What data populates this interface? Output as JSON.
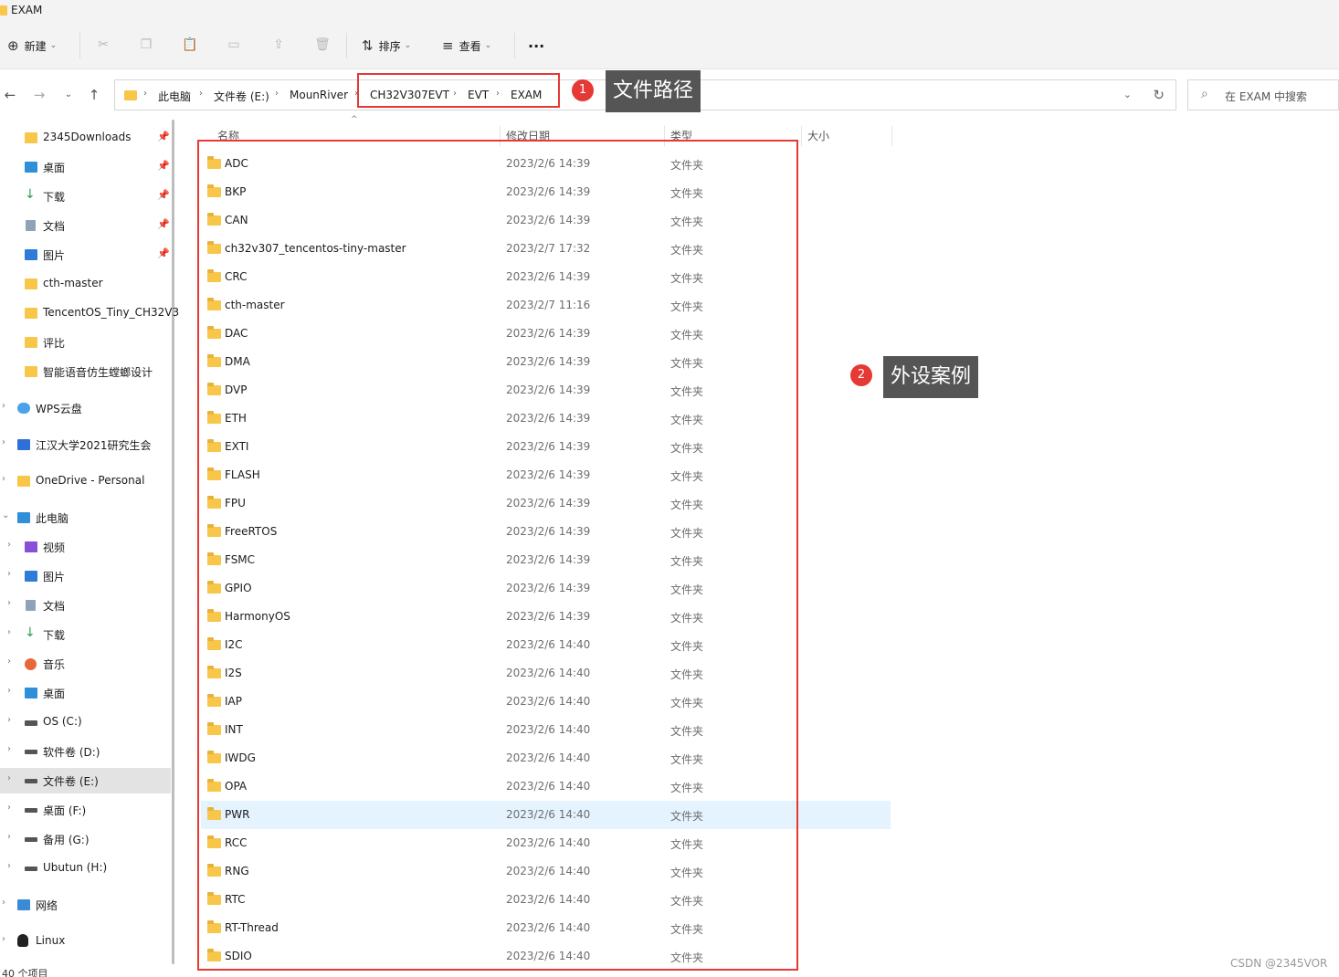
{
  "window": {
    "title": "EXAM"
  },
  "toolbar": {
    "new_label": "新建",
    "sort_label": "排序",
    "view_label": "查看",
    "more_label": "···"
  },
  "nav": {
    "breadcrumbs": [
      "此电脑",
      "文件卷 (E:)",
      "MounRiver",
      "CH32V307EVT",
      "EVT",
      "EXAM"
    ],
    "search_placeholder": "在 EXAM 中搜索"
  },
  "annotations": [
    {
      "number": "1",
      "text": "文件路径"
    },
    {
      "number": "2",
      "text": "外设案例"
    }
  ],
  "sidebar": {
    "quick_access": [
      {
        "label": "2345Downloads",
        "icon": "folder-icon",
        "pinned": true
      },
      {
        "label": "桌面",
        "icon": "desktop-icon",
        "pinned": true
      },
      {
        "label": "下载",
        "icon": "download-icon",
        "pinned": true
      },
      {
        "label": "文档",
        "icon": "document-icon",
        "pinned": true
      },
      {
        "label": "图片",
        "icon": "picture-icon",
        "pinned": true
      },
      {
        "label": "cth-master",
        "icon": "folder-icon",
        "pinned": false
      },
      {
        "label": "TencentOS_Tiny_CH32V3",
        "icon": "folder-icon",
        "pinned": false
      },
      {
        "label": "评比",
        "icon": "folder-icon",
        "pinned": false
      },
      {
        "label": "智能语音仿生螳螂设计",
        "icon": "folder-icon",
        "pinned": false
      }
    ],
    "roots": [
      {
        "label": "WPS云盘",
        "icon": "cloud-icon"
      },
      {
        "label": "江汉大学2021研究生会",
        "icon": "cloud-drive-icon"
      },
      {
        "label": "OneDrive - Personal",
        "icon": "onedrive-folder-icon"
      },
      {
        "label": "此电脑",
        "icon": "pc-icon"
      }
    ],
    "this_pc": [
      {
        "label": "视频",
        "icon": "video-icon"
      },
      {
        "label": "图片",
        "icon": "picture-icon"
      },
      {
        "label": "文档",
        "icon": "document-icon"
      },
      {
        "label": "下载",
        "icon": "download-icon"
      },
      {
        "label": "音乐",
        "icon": "music-icon"
      },
      {
        "label": "桌面",
        "icon": "desktop-icon"
      },
      {
        "label": "OS (C:)",
        "icon": "system-drive-icon"
      },
      {
        "label": "软件卷 (D:)",
        "icon": "drive-icon"
      },
      {
        "label": "文件卷 (E:)",
        "icon": "drive-icon",
        "selected": true
      },
      {
        "label": "桌面 (F:)",
        "icon": "drive-icon"
      },
      {
        "label": "备用 (G:)",
        "icon": "drive-icon"
      },
      {
        "label": "Ubutun (H:)",
        "icon": "drive-icon"
      }
    ],
    "bottom": [
      {
        "label": "网络",
        "icon": "network-icon"
      },
      {
        "label": "Linux",
        "icon": "linux-icon"
      }
    ],
    "status": "40 个项目"
  },
  "columns": {
    "name": "名称",
    "date": "修改日期",
    "type": "类型",
    "size": "大小"
  },
  "files": [
    {
      "name": "ADC",
      "date": "2023/2/6 14:39",
      "type": "文件夹"
    },
    {
      "name": "BKP",
      "date": "2023/2/6 14:39",
      "type": "文件夹"
    },
    {
      "name": "CAN",
      "date": "2023/2/6 14:39",
      "type": "文件夹"
    },
    {
      "name": "ch32v307_tencentos-tiny-master",
      "date": "2023/2/7 17:32",
      "type": "文件夹"
    },
    {
      "name": "CRC",
      "date": "2023/2/6 14:39",
      "type": "文件夹"
    },
    {
      "name": "cth-master",
      "date": "2023/2/7 11:16",
      "type": "文件夹"
    },
    {
      "name": "DAC",
      "date": "2023/2/6 14:39",
      "type": "文件夹"
    },
    {
      "name": "DMA",
      "date": "2023/2/6 14:39",
      "type": "文件夹"
    },
    {
      "name": "DVP",
      "date": "2023/2/6 14:39",
      "type": "文件夹"
    },
    {
      "name": "ETH",
      "date": "2023/2/6 14:39",
      "type": "文件夹"
    },
    {
      "name": "EXTI",
      "date": "2023/2/6 14:39",
      "type": "文件夹"
    },
    {
      "name": "FLASH",
      "date": "2023/2/6 14:39",
      "type": "文件夹"
    },
    {
      "name": "FPU",
      "date": "2023/2/6 14:39",
      "type": "文件夹"
    },
    {
      "name": "FreeRTOS",
      "date": "2023/2/6 14:39",
      "type": "文件夹"
    },
    {
      "name": "FSMC",
      "date": "2023/2/6 14:39",
      "type": "文件夹"
    },
    {
      "name": "GPIO",
      "date": "2023/2/6 14:39",
      "type": "文件夹"
    },
    {
      "name": "HarmonyOS",
      "date": "2023/2/6 14:39",
      "type": "文件夹"
    },
    {
      "name": "I2C",
      "date": "2023/2/6 14:40",
      "type": "文件夹"
    },
    {
      "name": "I2S",
      "date": "2023/2/6 14:40",
      "type": "文件夹"
    },
    {
      "name": "IAP",
      "date": "2023/2/6 14:40",
      "type": "文件夹"
    },
    {
      "name": "INT",
      "date": "2023/2/6 14:40",
      "type": "文件夹"
    },
    {
      "name": "IWDG",
      "date": "2023/2/6 14:40",
      "type": "文件夹"
    },
    {
      "name": "OPA",
      "date": "2023/2/6 14:40",
      "type": "文件夹"
    },
    {
      "name": "PWR",
      "date": "2023/2/6 14:40",
      "type": "文件夹",
      "highlighted": true
    },
    {
      "name": "RCC",
      "date": "2023/2/6 14:40",
      "type": "文件夹"
    },
    {
      "name": "RNG",
      "date": "2023/2/6 14:40",
      "type": "文件夹"
    },
    {
      "name": "RTC",
      "date": "2023/2/6 14:40",
      "type": "文件夹"
    },
    {
      "name": "RT-Thread",
      "date": "2023/2/6 14:40",
      "type": "文件夹"
    },
    {
      "name": "SDIO",
      "date": "2023/2/6 14:40",
      "type": "文件夹"
    }
  ],
  "watermark": "CSDN @2345VOR",
  "colors": {
    "annotation_red": "#e53935",
    "callout_gray": "#555555",
    "folder_yellow": "#f8c648",
    "hover_row": "#e5f3ff",
    "selected_nav": "#e3e3e3"
  }
}
